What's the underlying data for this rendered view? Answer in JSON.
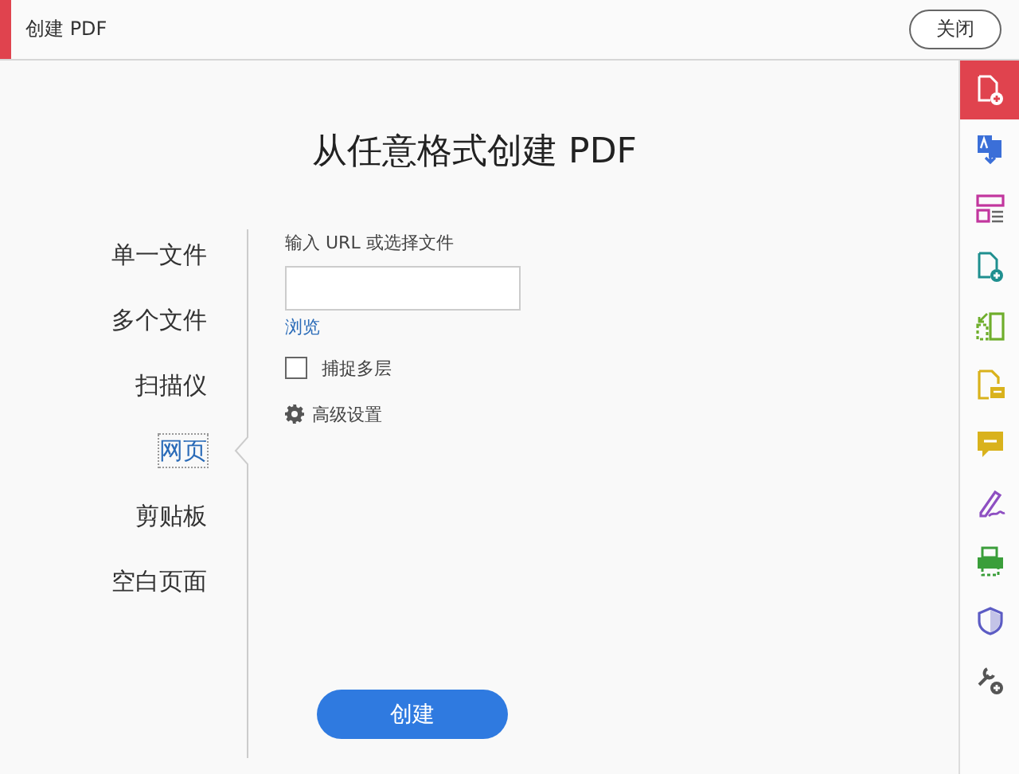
{
  "header": {
    "title": "创建 PDF",
    "close_button": "关闭"
  },
  "heading": "从任意格式创建 PDF",
  "sources": [
    {
      "label": "单一文件",
      "selected": false
    },
    {
      "label": "多个文件",
      "selected": false
    },
    {
      "label": "扫描仪",
      "selected": false
    },
    {
      "label": "网页",
      "selected": true
    },
    {
      "label": "剪贴板",
      "selected": false
    },
    {
      "label": "空白页面",
      "selected": false
    }
  ],
  "form": {
    "url_label": "输入 URL 或选择文件",
    "browse_link": "浏览",
    "capture_checkbox": {
      "label": "捕捉多层",
      "checked": false
    },
    "advanced_settings": "高级设置"
  },
  "create_button": "创建",
  "tools": [
    {
      "kind": "doc-plus",
      "color": "#ffffff",
      "selected": true
    },
    {
      "kind": "doc-arrow",
      "color": "#3b6fd8",
      "selected": false
    },
    {
      "kind": "layout",
      "color": "#c2369e",
      "selected": false
    },
    {
      "kind": "doc-plus",
      "color": "#1f8f8f",
      "selected": false
    },
    {
      "kind": "frame",
      "color": "#6fae2c",
      "selected": false
    },
    {
      "kind": "doc-note",
      "color": "#d9b21c",
      "selected": false
    },
    {
      "kind": "bubble",
      "color": "#d9b21c",
      "selected": false
    },
    {
      "kind": "pen",
      "color": "#8e4fc2",
      "selected": false
    },
    {
      "kind": "printer",
      "color": "#3a9e3a",
      "selected": false
    },
    {
      "kind": "shield",
      "color": "#5c5cc4",
      "selected": false
    },
    {
      "kind": "wrench",
      "color": "#555555",
      "selected": false
    }
  ]
}
